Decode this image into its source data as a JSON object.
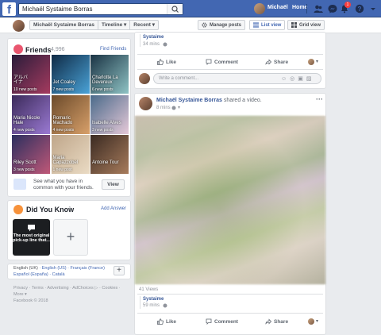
{
  "topbar": {
    "search_value": "Michaël Systaime Borras",
    "user_name": "Michaël",
    "home_label": "Home",
    "notifications_count": "1"
  },
  "subbar": {
    "crumbs": [
      "Michaël Systaime Borras",
      "Timeline",
      "Recent"
    ],
    "manage_posts": "Manage posts",
    "list_view": "List view",
    "grid_view": "Grid view"
  },
  "friends": {
    "title": "Friends",
    "count": "4,996",
    "find_link": "Find Friends",
    "tiles": [
      {
        "name": "アルバ\nイナ",
        "new": "10 new posts",
        "c1": "#2a1c3a",
        "c2": "#a53b5f"
      },
      {
        "name": "Jet Coaley",
        "new": "7 new posts",
        "c1": "#0f2a45",
        "c2": "#4aa3d8"
      },
      {
        "name": "Charlotte La\nDevereux",
        "new": "6 new posts",
        "c1": "#1a3344",
        "c2": "#8fc3c4"
      },
      {
        "name": "Maria Nicole\nHale",
        "new": "4 new posts",
        "c1": "#3b2a5a",
        "c2": "#9b7ad3"
      },
      {
        "name": "Romaric\nMachado",
        "new": "4 new posts",
        "c1": "#6b4a2a",
        "c2": "#d8a06a"
      },
      {
        "name": "Isabelle Alves",
        "new": "3 new posts",
        "c1": "#4a6a8a",
        "c2": "#e6c9d8"
      },
      {
        "name": "Riley Scott",
        "new": "3 new posts",
        "c1": "#2b2f5f",
        "c2": "#c05878"
      },
      {
        "name": "Maria\nCapazzobel",
        "new": "1 new post",
        "c1": "#bfa68a",
        "c2": "#eadbc4"
      },
      {
        "name": "Antoine Tour",
        "new": "",
        "c1": "#3a2a22",
        "c2": "#a87c5c"
      }
    ],
    "common_text": "See what you have in common with your friends.",
    "view_btn": "View"
  },
  "did_you_know": {
    "title": "Did You Know",
    "count": "1",
    "add_answer": "Add Answer",
    "card_text": "The most original pick-up line that..."
  },
  "languages": {
    "row1": [
      "English (UK)",
      "English (US)",
      "Français (France)"
    ],
    "row2": [
      "Español (España)",
      "Català"
    ]
  },
  "footer": {
    "links_line1": "Privacy · Terms · Advertising · AdChoices ▷ · Cookies ·",
    "links_line2": "More ▾",
    "copyright": "Facebook © 2018"
  },
  "post1": {
    "author": "Systaime",
    "time": "34 mins",
    "like": "Like",
    "comment": "Comment",
    "share": "Share",
    "comment_placeholder": "Write a comment..."
  },
  "post2": {
    "author": "Michaël Systaime Borras",
    "action_text": " shared a video.",
    "time": "8 mins",
    "views": "41 Views",
    "shared_author": "Systaime",
    "shared_time": "59 mins",
    "like": "Like",
    "comment": "Comment",
    "share": "Share"
  },
  "colors": {
    "brand": "#4267b2",
    "link": "#385898",
    "bg": "#e9ebee"
  }
}
